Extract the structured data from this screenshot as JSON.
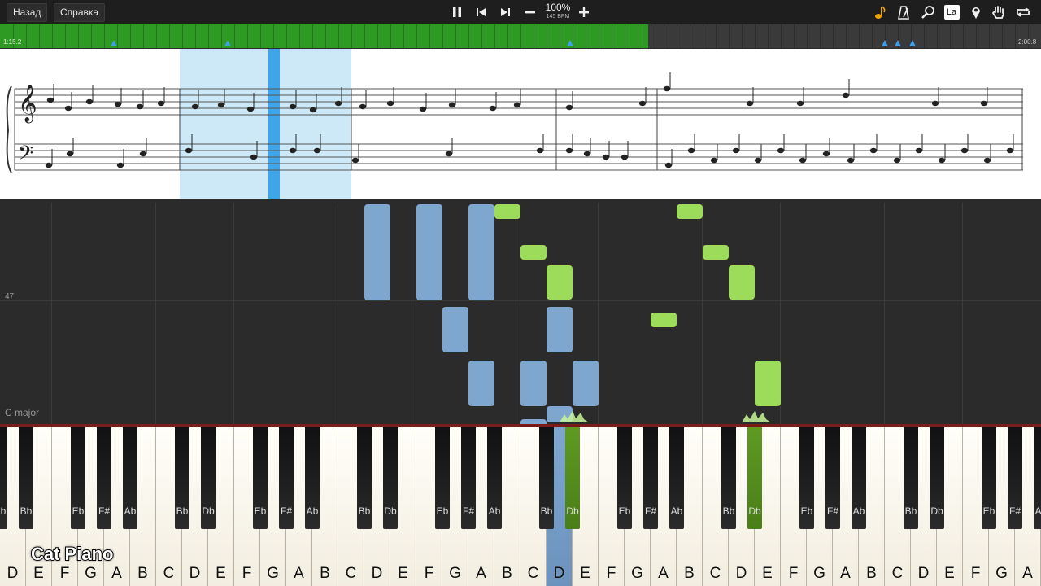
{
  "toolbar": {
    "back_label": "Назад",
    "help_label": "Справка",
    "tempo_percent": "100%",
    "tempo_bpm": "145 BPM",
    "icons": [
      "pause-icon",
      "prev-icon",
      "next-icon",
      "minus-icon",
      "plus-icon",
      "note-icon",
      "metronome-icon",
      "search-icon",
      "key-label-icon",
      "marker-icon",
      "hand-icon",
      "loop-icon"
    ],
    "key_label_button": "La"
  },
  "timeline": {
    "start_time": "1:15.2",
    "end_time": "2:00.8",
    "progress": 0.623,
    "accent": "#2f9a23"
  },
  "sheet": {
    "description_colors": {
      "highlight": "#cde9f8",
      "cursor": "#3da5e8"
    }
  },
  "roll": {
    "row_label": "47",
    "key_signature": "C major",
    "colors": {
      "left_hand": "#7fa6cf",
      "right_hand": "#9ddc5a"
    }
  },
  "keyboard": {
    "white_keys": [
      "D",
      "E",
      "F",
      "G",
      "A",
      "B",
      "C",
      "D",
      "E",
      "F",
      "G",
      "A",
      "B",
      "C",
      "D",
      "E",
      "F",
      "G",
      "A",
      "B",
      "C",
      "D",
      "E",
      "F",
      "G",
      "A",
      "B",
      "C",
      "D",
      "E",
      "F",
      "G",
      "A",
      "B",
      "C",
      "D",
      "E",
      "F",
      "G",
      "A"
    ],
    "black_keys": [
      "Bb",
      "Eb",
      "F#",
      "Ab",
      "Bb",
      "Db",
      "Eb",
      "F#",
      "Ab",
      "Bb",
      "Db",
      "Eb",
      "F#",
      "Ab",
      "Bb",
      "Db",
      "Eb",
      "F#",
      "Ab",
      "Bb",
      "Db",
      "Eb",
      "F#",
      "Ab",
      "Bb",
      "Db",
      "Eb",
      "F#",
      "Ab"
    ],
    "brand": "Cat Piano"
  }
}
